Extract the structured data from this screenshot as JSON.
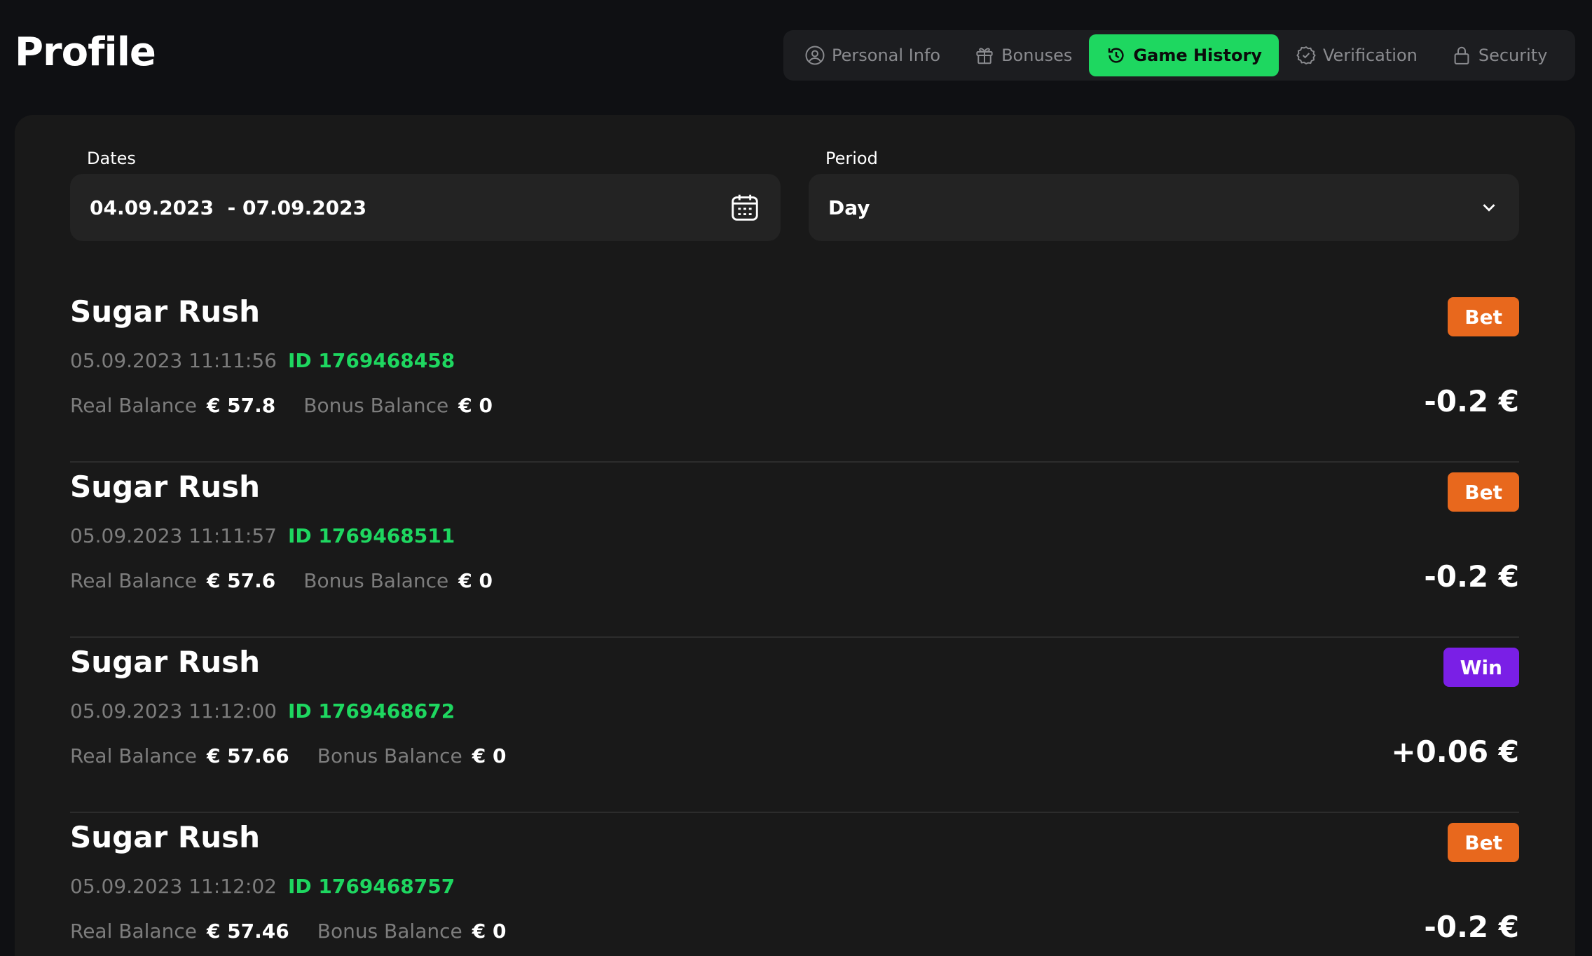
{
  "page_title": "Profile",
  "tabs": [
    {
      "label": "Personal Info",
      "icon": "user-circle-icon",
      "active": false
    },
    {
      "label": "Bonuses",
      "icon": "gift-icon",
      "active": false
    },
    {
      "label": "Game History",
      "icon": "history-icon",
      "active": true
    },
    {
      "label": "Verification",
      "icon": "badge-check-icon",
      "active": false
    },
    {
      "label": "Security",
      "icon": "lock-icon",
      "active": false
    }
  ],
  "filters": {
    "dates_label": "Dates",
    "dates_value": "04.09.2023  - 07.09.2023",
    "period_label": "Period",
    "period_value": "Day"
  },
  "history": [
    {
      "game": "Sugar Rush",
      "datetime": "05.09.2023 11:11:56",
      "tx_id": "ID 1769468458",
      "real_label": "Real Balance",
      "real_value": "€ 57.8",
      "bonus_label": "Bonus Balance",
      "bonus_value": "€ 0",
      "type": "Bet",
      "amount": "-0.2 €"
    },
    {
      "game": "Sugar Rush",
      "datetime": "05.09.2023 11:11:57",
      "tx_id": "ID 1769468511",
      "real_label": "Real Balance",
      "real_value": "€ 57.6",
      "bonus_label": "Bonus Balance",
      "bonus_value": "€ 0",
      "type": "Bet",
      "amount": "-0.2 €"
    },
    {
      "game": "Sugar Rush",
      "datetime": "05.09.2023 11:12:00",
      "tx_id": "ID 1769468672",
      "real_label": "Real Balance",
      "real_value": "€ 57.66",
      "bonus_label": "Bonus Balance",
      "bonus_value": "€ 0",
      "type": "Win",
      "amount": "+0.06 €"
    },
    {
      "game": "Sugar Rush",
      "datetime": "05.09.2023 11:12:02",
      "tx_id": "ID 1769468757",
      "real_label": "Real Balance",
      "real_value": "€ 57.46",
      "bonus_label": "Bonus Balance",
      "bonus_value": "€ 0",
      "type": "Bet",
      "amount": "-0.2 €"
    }
  ],
  "colors": {
    "accent_green": "#1ed760",
    "bet_badge": "#e8681d",
    "win_badge": "#7a1fe6",
    "background": "#0f1013",
    "panel": "#191919"
  }
}
